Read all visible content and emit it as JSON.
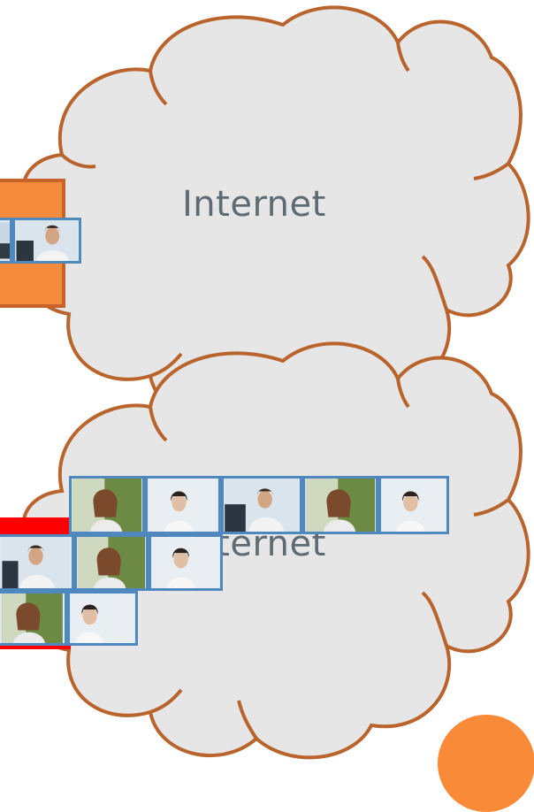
{
  "clouds": [
    {
      "label": "Internet"
    },
    {
      "label": "Internet"
    }
  ],
  "colors": {
    "cloud_fill": "#e6e6e6",
    "cloud_outline": "#b8642c",
    "label_text": "#5f6b73",
    "device_orange": "#f48a3c",
    "device_red": "#ff0000",
    "thumb_border": "#4f87bf",
    "accent_circle": "#f98a37"
  },
  "participants": [
    {
      "icon": "man-at-desk-photo"
    },
    {
      "icon": "woman-with-laptop-photo"
    },
    {
      "icon": "woman-headset-photo"
    }
  ]
}
